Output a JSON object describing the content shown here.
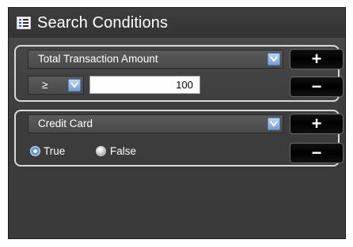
{
  "window": {
    "title": "Search Conditions",
    "icon": "list-icon"
  },
  "conditions": [
    {
      "field": "Total Transaction Amount",
      "operator": "≥",
      "value": "100",
      "add_label": "+",
      "remove_label": "−"
    },
    {
      "field": "Credit Card",
      "options": [
        {
          "label": "True",
          "selected": true
        },
        {
          "label": "False",
          "selected": false
        }
      ],
      "add_label": "+",
      "remove_label": "−"
    }
  ],
  "colors": {
    "accent": "#6f9fd6",
    "panel": "#3a3a3a",
    "border": "#d9d9d9"
  }
}
